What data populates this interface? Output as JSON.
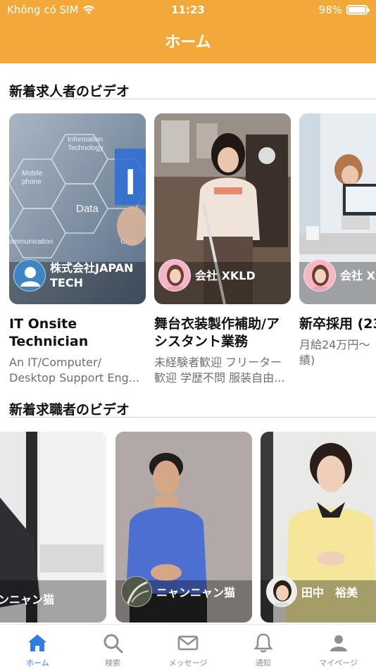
{
  "status": {
    "carrier": "Không có SIM",
    "time": "11:23",
    "battery": "98%",
    "battery_level": 0.98
  },
  "header": {
    "title": "ホーム"
  },
  "sections": {
    "jobs_title": "新着求人者のビデオ",
    "seekers_title": "新着求職者のビデオ"
  },
  "jobs": [
    {
      "company": "株式会社JAPAN\nTECH",
      "title": "IT Onsite\nTechnician",
      "desc": "An IT/Computer/\nDesktop Support Eng..."
    },
    {
      "company": "会社 XKLD",
      "title": "舞台衣装製作補助/ア\nシスタント業務",
      "desc": "未経験者歓迎 フリーター\n歓迎 学歴不問 服装自由..."
    },
    {
      "company": "会社 X",
      "title": "新卒採用 (23",
      "desc": "月給24万円〜\n績)"
    }
  ],
  "seekers": [
    {
      "name": "ニャンニャン猫"
    },
    {
      "name": "ニャンニャン猫"
    },
    {
      "name": "田中　裕美"
    }
  ],
  "tabs": [
    {
      "label": "ホーム",
      "icon": "home-icon",
      "active": true
    },
    {
      "label": "検索",
      "icon": "search-icon",
      "active": false
    },
    {
      "label": "メッセージ",
      "icon": "mail-icon",
      "active": false
    },
    {
      "label": "通知",
      "icon": "bell-icon",
      "active": false
    },
    {
      "label": "マイページ",
      "icon": "person-icon",
      "active": false
    }
  ],
  "colors": {
    "header": "#f3a83a",
    "tab_active": "#2f7de1",
    "tab_inactive": "#8e8e93"
  }
}
